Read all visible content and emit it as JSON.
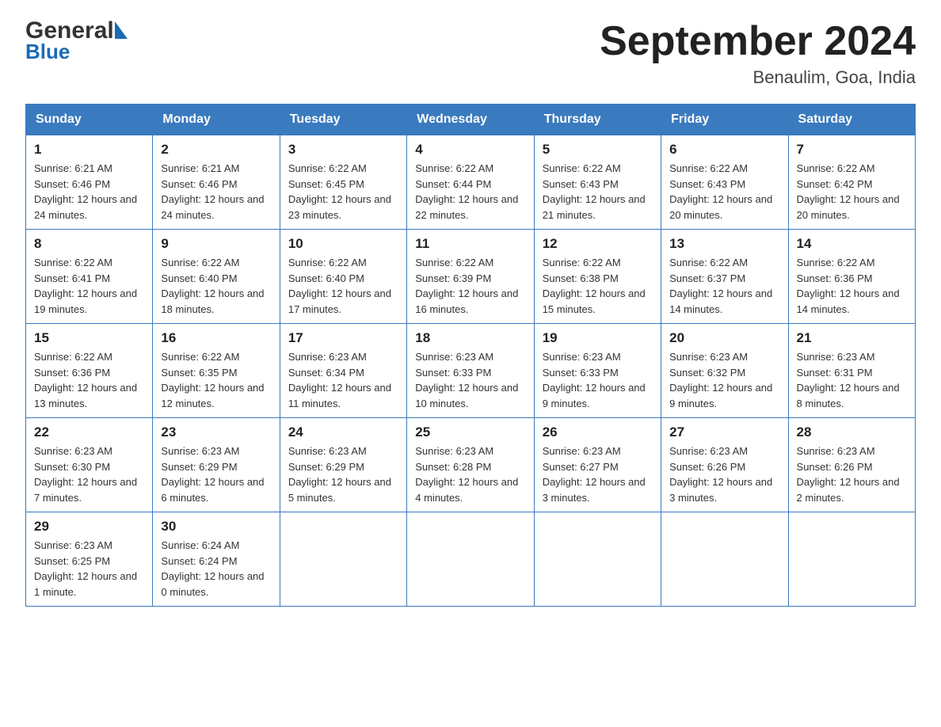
{
  "logo": {
    "general": "General",
    "blue": "Blue"
  },
  "title": "September 2024",
  "location": "Benaulim, Goa, India",
  "days_of_week": [
    "Sunday",
    "Monday",
    "Tuesday",
    "Wednesday",
    "Thursday",
    "Friday",
    "Saturday"
  ],
  "weeks": [
    [
      {
        "day": "1",
        "sunrise": "Sunrise: 6:21 AM",
        "sunset": "Sunset: 6:46 PM",
        "daylight": "Daylight: 12 hours and 24 minutes."
      },
      {
        "day": "2",
        "sunrise": "Sunrise: 6:21 AM",
        "sunset": "Sunset: 6:46 PM",
        "daylight": "Daylight: 12 hours and 24 minutes."
      },
      {
        "day": "3",
        "sunrise": "Sunrise: 6:22 AM",
        "sunset": "Sunset: 6:45 PM",
        "daylight": "Daylight: 12 hours and 23 minutes."
      },
      {
        "day": "4",
        "sunrise": "Sunrise: 6:22 AM",
        "sunset": "Sunset: 6:44 PM",
        "daylight": "Daylight: 12 hours and 22 minutes."
      },
      {
        "day": "5",
        "sunrise": "Sunrise: 6:22 AM",
        "sunset": "Sunset: 6:43 PM",
        "daylight": "Daylight: 12 hours and 21 minutes."
      },
      {
        "day": "6",
        "sunrise": "Sunrise: 6:22 AM",
        "sunset": "Sunset: 6:43 PM",
        "daylight": "Daylight: 12 hours and 20 minutes."
      },
      {
        "day": "7",
        "sunrise": "Sunrise: 6:22 AM",
        "sunset": "Sunset: 6:42 PM",
        "daylight": "Daylight: 12 hours and 20 minutes."
      }
    ],
    [
      {
        "day": "8",
        "sunrise": "Sunrise: 6:22 AM",
        "sunset": "Sunset: 6:41 PM",
        "daylight": "Daylight: 12 hours and 19 minutes."
      },
      {
        "day": "9",
        "sunrise": "Sunrise: 6:22 AM",
        "sunset": "Sunset: 6:40 PM",
        "daylight": "Daylight: 12 hours and 18 minutes."
      },
      {
        "day": "10",
        "sunrise": "Sunrise: 6:22 AM",
        "sunset": "Sunset: 6:40 PM",
        "daylight": "Daylight: 12 hours and 17 minutes."
      },
      {
        "day": "11",
        "sunrise": "Sunrise: 6:22 AM",
        "sunset": "Sunset: 6:39 PM",
        "daylight": "Daylight: 12 hours and 16 minutes."
      },
      {
        "day": "12",
        "sunrise": "Sunrise: 6:22 AM",
        "sunset": "Sunset: 6:38 PM",
        "daylight": "Daylight: 12 hours and 15 minutes."
      },
      {
        "day": "13",
        "sunrise": "Sunrise: 6:22 AM",
        "sunset": "Sunset: 6:37 PM",
        "daylight": "Daylight: 12 hours and 14 minutes."
      },
      {
        "day": "14",
        "sunrise": "Sunrise: 6:22 AM",
        "sunset": "Sunset: 6:36 PM",
        "daylight": "Daylight: 12 hours and 14 minutes."
      }
    ],
    [
      {
        "day": "15",
        "sunrise": "Sunrise: 6:22 AM",
        "sunset": "Sunset: 6:36 PM",
        "daylight": "Daylight: 12 hours and 13 minutes."
      },
      {
        "day": "16",
        "sunrise": "Sunrise: 6:22 AM",
        "sunset": "Sunset: 6:35 PM",
        "daylight": "Daylight: 12 hours and 12 minutes."
      },
      {
        "day": "17",
        "sunrise": "Sunrise: 6:23 AM",
        "sunset": "Sunset: 6:34 PM",
        "daylight": "Daylight: 12 hours and 11 minutes."
      },
      {
        "day": "18",
        "sunrise": "Sunrise: 6:23 AM",
        "sunset": "Sunset: 6:33 PM",
        "daylight": "Daylight: 12 hours and 10 minutes."
      },
      {
        "day": "19",
        "sunrise": "Sunrise: 6:23 AM",
        "sunset": "Sunset: 6:33 PM",
        "daylight": "Daylight: 12 hours and 9 minutes."
      },
      {
        "day": "20",
        "sunrise": "Sunrise: 6:23 AM",
        "sunset": "Sunset: 6:32 PM",
        "daylight": "Daylight: 12 hours and 9 minutes."
      },
      {
        "day": "21",
        "sunrise": "Sunrise: 6:23 AM",
        "sunset": "Sunset: 6:31 PM",
        "daylight": "Daylight: 12 hours and 8 minutes."
      }
    ],
    [
      {
        "day": "22",
        "sunrise": "Sunrise: 6:23 AM",
        "sunset": "Sunset: 6:30 PM",
        "daylight": "Daylight: 12 hours and 7 minutes."
      },
      {
        "day": "23",
        "sunrise": "Sunrise: 6:23 AM",
        "sunset": "Sunset: 6:29 PM",
        "daylight": "Daylight: 12 hours and 6 minutes."
      },
      {
        "day": "24",
        "sunrise": "Sunrise: 6:23 AM",
        "sunset": "Sunset: 6:29 PM",
        "daylight": "Daylight: 12 hours and 5 minutes."
      },
      {
        "day": "25",
        "sunrise": "Sunrise: 6:23 AM",
        "sunset": "Sunset: 6:28 PM",
        "daylight": "Daylight: 12 hours and 4 minutes."
      },
      {
        "day": "26",
        "sunrise": "Sunrise: 6:23 AM",
        "sunset": "Sunset: 6:27 PM",
        "daylight": "Daylight: 12 hours and 3 minutes."
      },
      {
        "day": "27",
        "sunrise": "Sunrise: 6:23 AM",
        "sunset": "Sunset: 6:26 PM",
        "daylight": "Daylight: 12 hours and 3 minutes."
      },
      {
        "day": "28",
        "sunrise": "Sunrise: 6:23 AM",
        "sunset": "Sunset: 6:26 PM",
        "daylight": "Daylight: 12 hours and 2 minutes."
      }
    ],
    [
      {
        "day": "29",
        "sunrise": "Sunrise: 6:23 AM",
        "sunset": "Sunset: 6:25 PM",
        "daylight": "Daylight: 12 hours and 1 minute."
      },
      {
        "day": "30",
        "sunrise": "Sunrise: 6:24 AM",
        "sunset": "Sunset: 6:24 PM",
        "daylight": "Daylight: 12 hours and 0 minutes."
      },
      null,
      null,
      null,
      null,
      null
    ]
  ]
}
